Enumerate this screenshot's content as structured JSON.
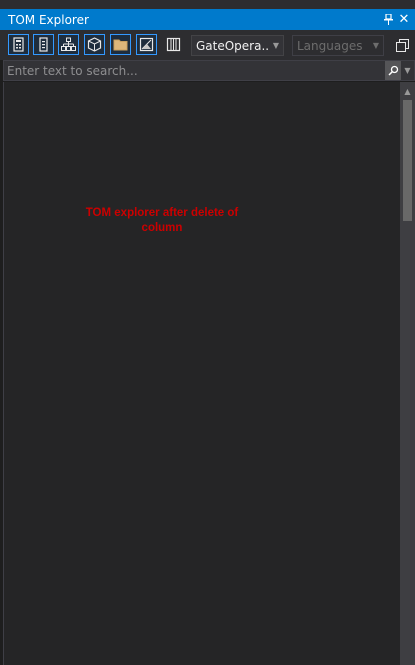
{
  "window": {
    "title": "TOM Explorer",
    "pin_icon": "pin-icon",
    "close_icon": "close-icon"
  },
  "toolbar": {
    "buttons": [
      {
        "icon": "calculator-icon"
      },
      {
        "icon": "device-icon"
      },
      {
        "icon": "hierarchy-icon"
      },
      {
        "icon": "cube-icon"
      },
      {
        "icon": "folder-icon"
      },
      {
        "icon": "image-icon"
      },
      {
        "icon": "columns-icon"
      }
    ],
    "model_dropdown": {
      "value": "GateOpera..."
    },
    "languages_dropdown": {
      "placeholder": "Languages"
    },
    "copy_icon": "copy-icon"
  },
  "search": {
    "placeholder": "Enter text to search...",
    "value": ""
  },
  "annotation": {
    "text": "TOM explorer after delete of column"
  },
  "colors": {
    "accent": "#007acc",
    "annotation": "#cc0000",
    "background": "#252526"
  }
}
